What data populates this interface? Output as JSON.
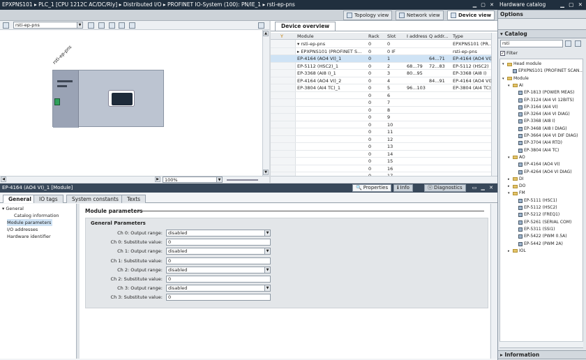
{
  "title_bar": {
    "path": "EPXPNS101 ▸ PLC_1 [CPU 1212C AC/DC/Rly] ▸ Distributed I/O ▸ PROFINET IO-System (100): PN/IE_1 ▸ rsti-ep-pns",
    "right_title": "Hardware catalog"
  },
  "views": {
    "topology": "Topology view",
    "network": "Network view",
    "device": "Device view"
  },
  "device_canvas": {
    "device_selector": "rsti-ep-pns",
    "station_label": "rsti-ep-pns",
    "zoom": "100%"
  },
  "overview": {
    "tab": "Device overview",
    "columns": [
      "Module",
      "Rack",
      "Slot",
      "I address",
      "Q addr...",
      "Type"
    ],
    "rows": [
      {
        "module": "▾ rsti-ep-pns",
        "rack": "0",
        "slot": "0",
        "i": "",
        "q": "",
        "type": "EPXPNS101 (PR..."
      },
      {
        "module": "▸ EPXPNS101 (PROFINET S...",
        "rack": "0",
        "slot": "0 IF",
        "i": "",
        "q": "",
        "type": "rsti-ep-pns"
      },
      {
        "module": "EP-4164 (AO4 VI)_1",
        "rack": "0",
        "slot": "1",
        "i": "",
        "q": "64...71",
        "type": "EP-4164 (AO4 VI)",
        "selected": true
      },
      {
        "module": "EP-5112 (HSC2)_1",
        "rack": "0",
        "slot": "2",
        "i": "68...79",
        "q": "72...83",
        "type": "EP-5112 (HSC2)"
      },
      {
        "module": "EP-3368 (AI8 I)_1",
        "rack": "0",
        "slot": "3",
        "i": "80...95",
        "q": "",
        "type": "EP-3368 (AI8 I)"
      },
      {
        "module": "EP-4164 (AO4 VI)_2",
        "rack": "0",
        "slot": "4",
        "i": "",
        "q": "84...91",
        "type": "EP-4164 (AO4 VI)"
      },
      {
        "module": "EP-3804 (AI4 TC)_1",
        "rack": "0",
        "slot": "5",
        "i": "96...103",
        "q": "",
        "type": "EP-3804 (AI4 TC)"
      },
      {
        "module": "",
        "rack": "0",
        "slot": "6",
        "i": "",
        "q": "",
        "type": ""
      },
      {
        "module": "",
        "rack": "0",
        "slot": "7",
        "i": "",
        "q": "",
        "type": ""
      },
      {
        "module": "",
        "rack": "0",
        "slot": "8",
        "i": "",
        "q": "",
        "type": ""
      },
      {
        "module": "",
        "rack": "0",
        "slot": "9",
        "i": "",
        "q": "",
        "type": ""
      },
      {
        "module": "",
        "rack": "0",
        "slot": "10",
        "i": "",
        "q": "",
        "type": ""
      },
      {
        "module": "",
        "rack": "0",
        "slot": "11",
        "i": "",
        "q": "",
        "type": ""
      },
      {
        "module": "",
        "rack": "0",
        "slot": "12",
        "i": "",
        "q": "",
        "type": ""
      },
      {
        "module": "",
        "rack": "0",
        "slot": "13",
        "i": "",
        "q": "",
        "type": ""
      },
      {
        "module": "",
        "rack": "0",
        "slot": "14",
        "i": "",
        "q": "",
        "type": ""
      },
      {
        "module": "",
        "rack": "0",
        "slot": "15",
        "i": "",
        "q": "",
        "type": ""
      },
      {
        "module": "",
        "rack": "0",
        "slot": "16",
        "i": "",
        "q": "",
        "type": ""
      },
      {
        "module": "",
        "rack": "0",
        "slot": "17",
        "i": "",
        "q": "",
        "type": ""
      }
    ]
  },
  "properties": {
    "header": "EP-4164 (AO4 VI)_1 [Module]",
    "tabs": {
      "properties": "Properties",
      "info": "Info",
      "diagnostics": "Diagnostics"
    },
    "subtabs": [
      "General",
      "IO tags",
      "System constants",
      "Texts"
    ],
    "nav": [
      "▾ General",
      "Catalog information",
      "Module parameters",
      "I/O addresses",
      "Hardware identifier"
    ],
    "section_title": "Module parameters",
    "group_title": "General Parameters",
    "params": [
      {
        "label": "Ch 0: Output range:",
        "value": "disabled",
        "type": "select"
      },
      {
        "label": "Ch 0: Substitute value:",
        "value": "0",
        "type": "text"
      },
      {
        "label": "Ch 1: Output range:",
        "value": "disabled",
        "type": "select"
      },
      {
        "label": "Ch 1: Substitute value:",
        "value": "0",
        "type": "text"
      },
      {
        "label": "Ch 2: Output range:",
        "value": "disabled",
        "type": "select"
      },
      {
        "label": "Ch 2: Substitute value:",
        "value": "0",
        "type": "text"
      },
      {
        "label": "Ch 3: Output range:",
        "value": "disabled",
        "type": "select"
      },
      {
        "label": "Ch 3: Substitute value:",
        "value": "0",
        "type": "text"
      }
    ]
  },
  "catalog": {
    "options": "Options",
    "catalog": "Catalog",
    "search_value": "rsti",
    "filter": "Filter",
    "info": "Information",
    "tree": [
      {
        "label": "Head module",
        "level": 0,
        "kind": "folder",
        "exp": "▾"
      },
      {
        "label": "EPXPNS101 (PROFINET SCAN...",
        "level": 1,
        "kind": "item",
        "exp": ""
      },
      {
        "label": "Module",
        "level": 0,
        "kind": "folder",
        "exp": "▾"
      },
      {
        "label": "AI",
        "level": 1,
        "kind": "folder",
        "exp": "▾"
      },
      {
        "label": "EP-1813 (POWER MEAS)",
        "level": 2,
        "kind": "item",
        "exp": ""
      },
      {
        "label": "EP-3124 (AI4 VI 12BITS)",
        "level": 2,
        "kind": "item",
        "exp": ""
      },
      {
        "label": "EP-3164 (AI4 VI)",
        "level": 2,
        "kind": "item",
        "exp": ""
      },
      {
        "label": "EP-3264 (AI4 VI DIAG)",
        "level": 2,
        "kind": "item",
        "exp": ""
      },
      {
        "label": "EP-3368 (AI8 I)",
        "level": 2,
        "kind": "item",
        "exp": ""
      },
      {
        "label": "EP-3468 (AI8 I DIAG)",
        "level": 2,
        "kind": "item",
        "exp": ""
      },
      {
        "label": "EP-3664 (AI4 VI DIF DIAG)",
        "level": 2,
        "kind": "item",
        "exp": ""
      },
      {
        "label": "EP-3704 (AI4 RTD)",
        "level": 2,
        "kind": "item",
        "exp": ""
      },
      {
        "label": "EP-3804 (AI4 TC)",
        "level": 2,
        "kind": "item",
        "exp": ""
      },
      {
        "label": "AO",
        "level": 1,
        "kind": "folder",
        "exp": "▾"
      },
      {
        "label": "EP-4164 (AO4 VI)",
        "level": 2,
        "kind": "item",
        "exp": ""
      },
      {
        "label": "EP-4264 (AO4 VI DIAG)",
        "level": 2,
        "kind": "item",
        "exp": ""
      },
      {
        "label": "DI",
        "level": 1,
        "kind": "folder",
        "exp": "▸"
      },
      {
        "label": "DO",
        "level": 1,
        "kind": "folder",
        "exp": "▸"
      },
      {
        "label": "FM",
        "level": 1,
        "kind": "folder",
        "exp": "▾"
      },
      {
        "label": "EP-5111 (HSC1)",
        "level": 2,
        "kind": "item",
        "exp": ""
      },
      {
        "label": "EP-5112 (HSC2)",
        "level": 2,
        "kind": "item",
        "exp": ""
      },
      {
        "label": "EP-5212 (FREQ1)",
        "level": 2,
        "kind": "item",
        "exp": ""
      },
      {
        "label": "EP-5261 (SERIAL COM)",
        "level": 2,
        "kind": "item",
        "exp": ""
      },
      {
        "label": "EP-5311 (SSI1)",
        "level": 2,
        "kind": "item",
        "exp": ""
      },
      {
        "label": "EP-5422 (PWM 0.5A)",
        "level": 2,
        "kind": "item",
        "exp": ""
      },
      {
        "label": "EP-5442 (PWM 2A)",
        "level": 2,
        "kind": "item",
        "exp": ""
      },
      {
        "label": "IOL",
        "level": 1,
        "kind": "folder",
        "exp": "▸"
      }
    ]
  }
}
